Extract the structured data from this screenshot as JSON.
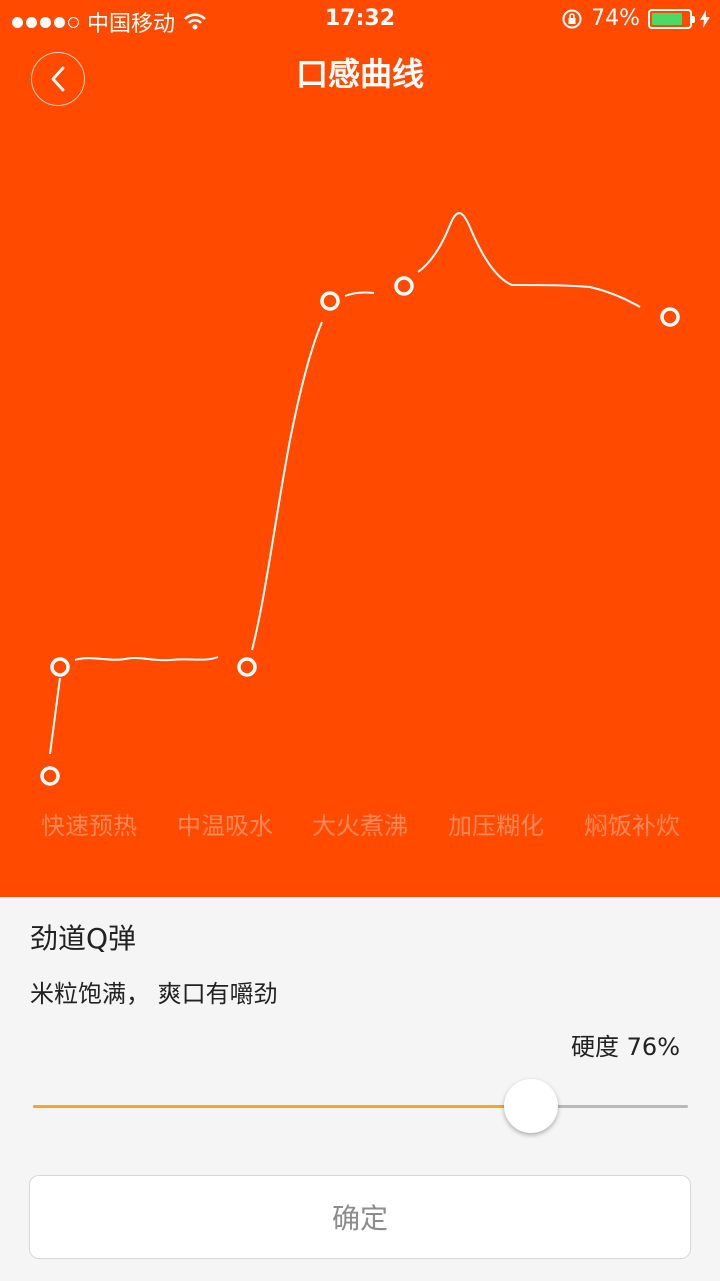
{
  "status_bar": {
    "carrier": "中国移动",
    "time": "17:32",
    "battery_percent": "74%",
    "battery_level": 0.74
  },
  "header": {
    "title": "口感曲线",
    "back_icon": "chevron-left-icon"
  },
  "curve": {
    "phases": [
      "快速预热",
      "中温吸水",
      "大火煮沸",
      "加压糊化",
      "焖饭补炊"
    ]
  },
  "texture": {
    "name": "劲道Q弹",
    "description": "米粒饱满，  爽口有嚼劲",
    "hardness_label": "硬度",
    "hardness_value": "76%",
    "hardness_level": 0.76
  },
  "confirm_label": "确定",
  "colors": {
    "accent": "#ff4a00",
    "slider_fill": "#f5a623"
  }
}
